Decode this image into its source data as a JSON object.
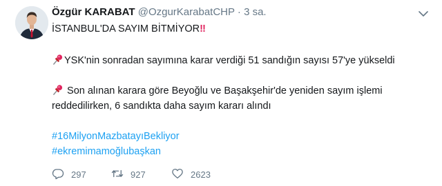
{
  "tweet": {
    "author_name": "Özgür KARABAT",
    "author_handle": "@OzgurKarabatCHP",
    "separator": "·",
    "time": "3 sa.",
    "line1": "İSTANBUL'DA SAYIM BİTMİYOR",
    "line1_emphasis": "‼",
    "line2": "YSK'nin sonradan sayımına karar verdiği 51 sandığın sayısı 57'ye yükseldi",
    "line3": " Son alınan karara göre Beyoğlu ve Başakşehir'de yeniden sayım işlemi",
    "line4": "reddedilirken, 6 sandıkta daha sayım kararı alındı",
    "hashtags": [
      "#16MilyonMazbatayıBekliyor",
      "#ekremimamoğlubaşkan"
    ],
    "stats": {
      "replies": "297",
      "retweets": "927",
      "likes": "2623"
    }
  },
  "icons": {
    "pin": "pushpin-icon",
    "reply": "reply-icon",
    "retweet": "retweet-icon",
    "like": "heart-icon",
    "menu": "chevron-down-icon"
  },
  "colors": {
    "link": "#1da1f2",
    "secondary_text": "#657786",
    "primary_text": "#14171a",
    "emphasis": "#e0245e"
  }
}
